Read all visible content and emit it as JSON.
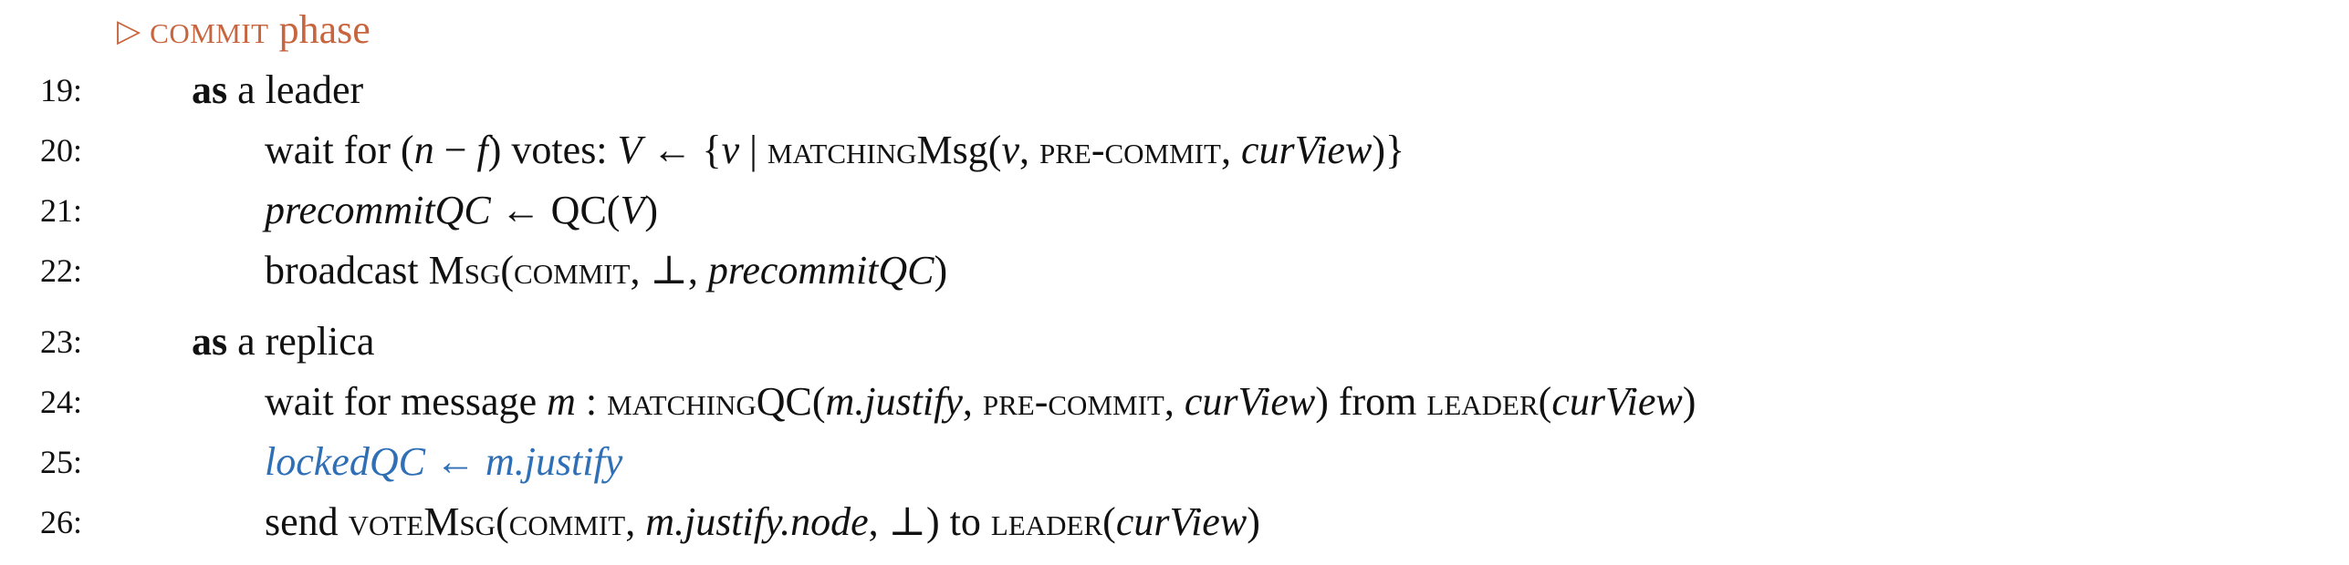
{
  "phase": {
    "marker": "▷",
    "label_sc": "commit",
    "label_rest": " phase"
  },
  "lines": [
    {
      "no": "19:",
      "kw": "as",
      "text": " a leader"
    },
    {
      "no": "20:",
      "parts": [
        "wait for (",
        "n",
        " − ",
        "f",
        ") votes: ",
        "V",
        " ← {",
        "v",
        " | ",
        "matching",
        "Msg(",
        "v",
        ", ",
        "pre-commit",
        ", ",
        "curView",
        ")}"
      ]
    },
    {
      "no": "21:",
      "parts": [
        "precommitQC",
        " ← QC(",
        "V",
        ")"
      ]
    },
    {
      "no": "22:",
      "parts": [
        "broadcast ",
        "Msg",
        "(",
        "commit",
        ", ⊥, ",
        "precommitQC",
        ")"
      ]
    },
    {
      "no": "23:",
      "kw": "as",
      "text": " a replica"
    },
    {
      "no": "24:",
      "parts": [
        "wait for message ",
        "m",
        " : ",
        "matching",
        "QC(",
        "m.justify",
        ", ",
        "pre-commit",
        ", ",
        "curView",
        ") from ",
        "leader",
        "(",
        "curView",
        ")"
      ]
    },
    {
      "no": "25:",
      "parts": [
        "lockedQC",
        " ← ",
        "m.justify"
      ]
    },
    {
      "no": "26:",
      "parts": [
        "send ",
        "vote",
        "Msg",
        "(",
        "commit",
        ", ",
        "m.justify.node",
        ", ⊥) to ",
        "leader",
        "(",
        "curView",
        ")"
      ]
    }
  ]
}
